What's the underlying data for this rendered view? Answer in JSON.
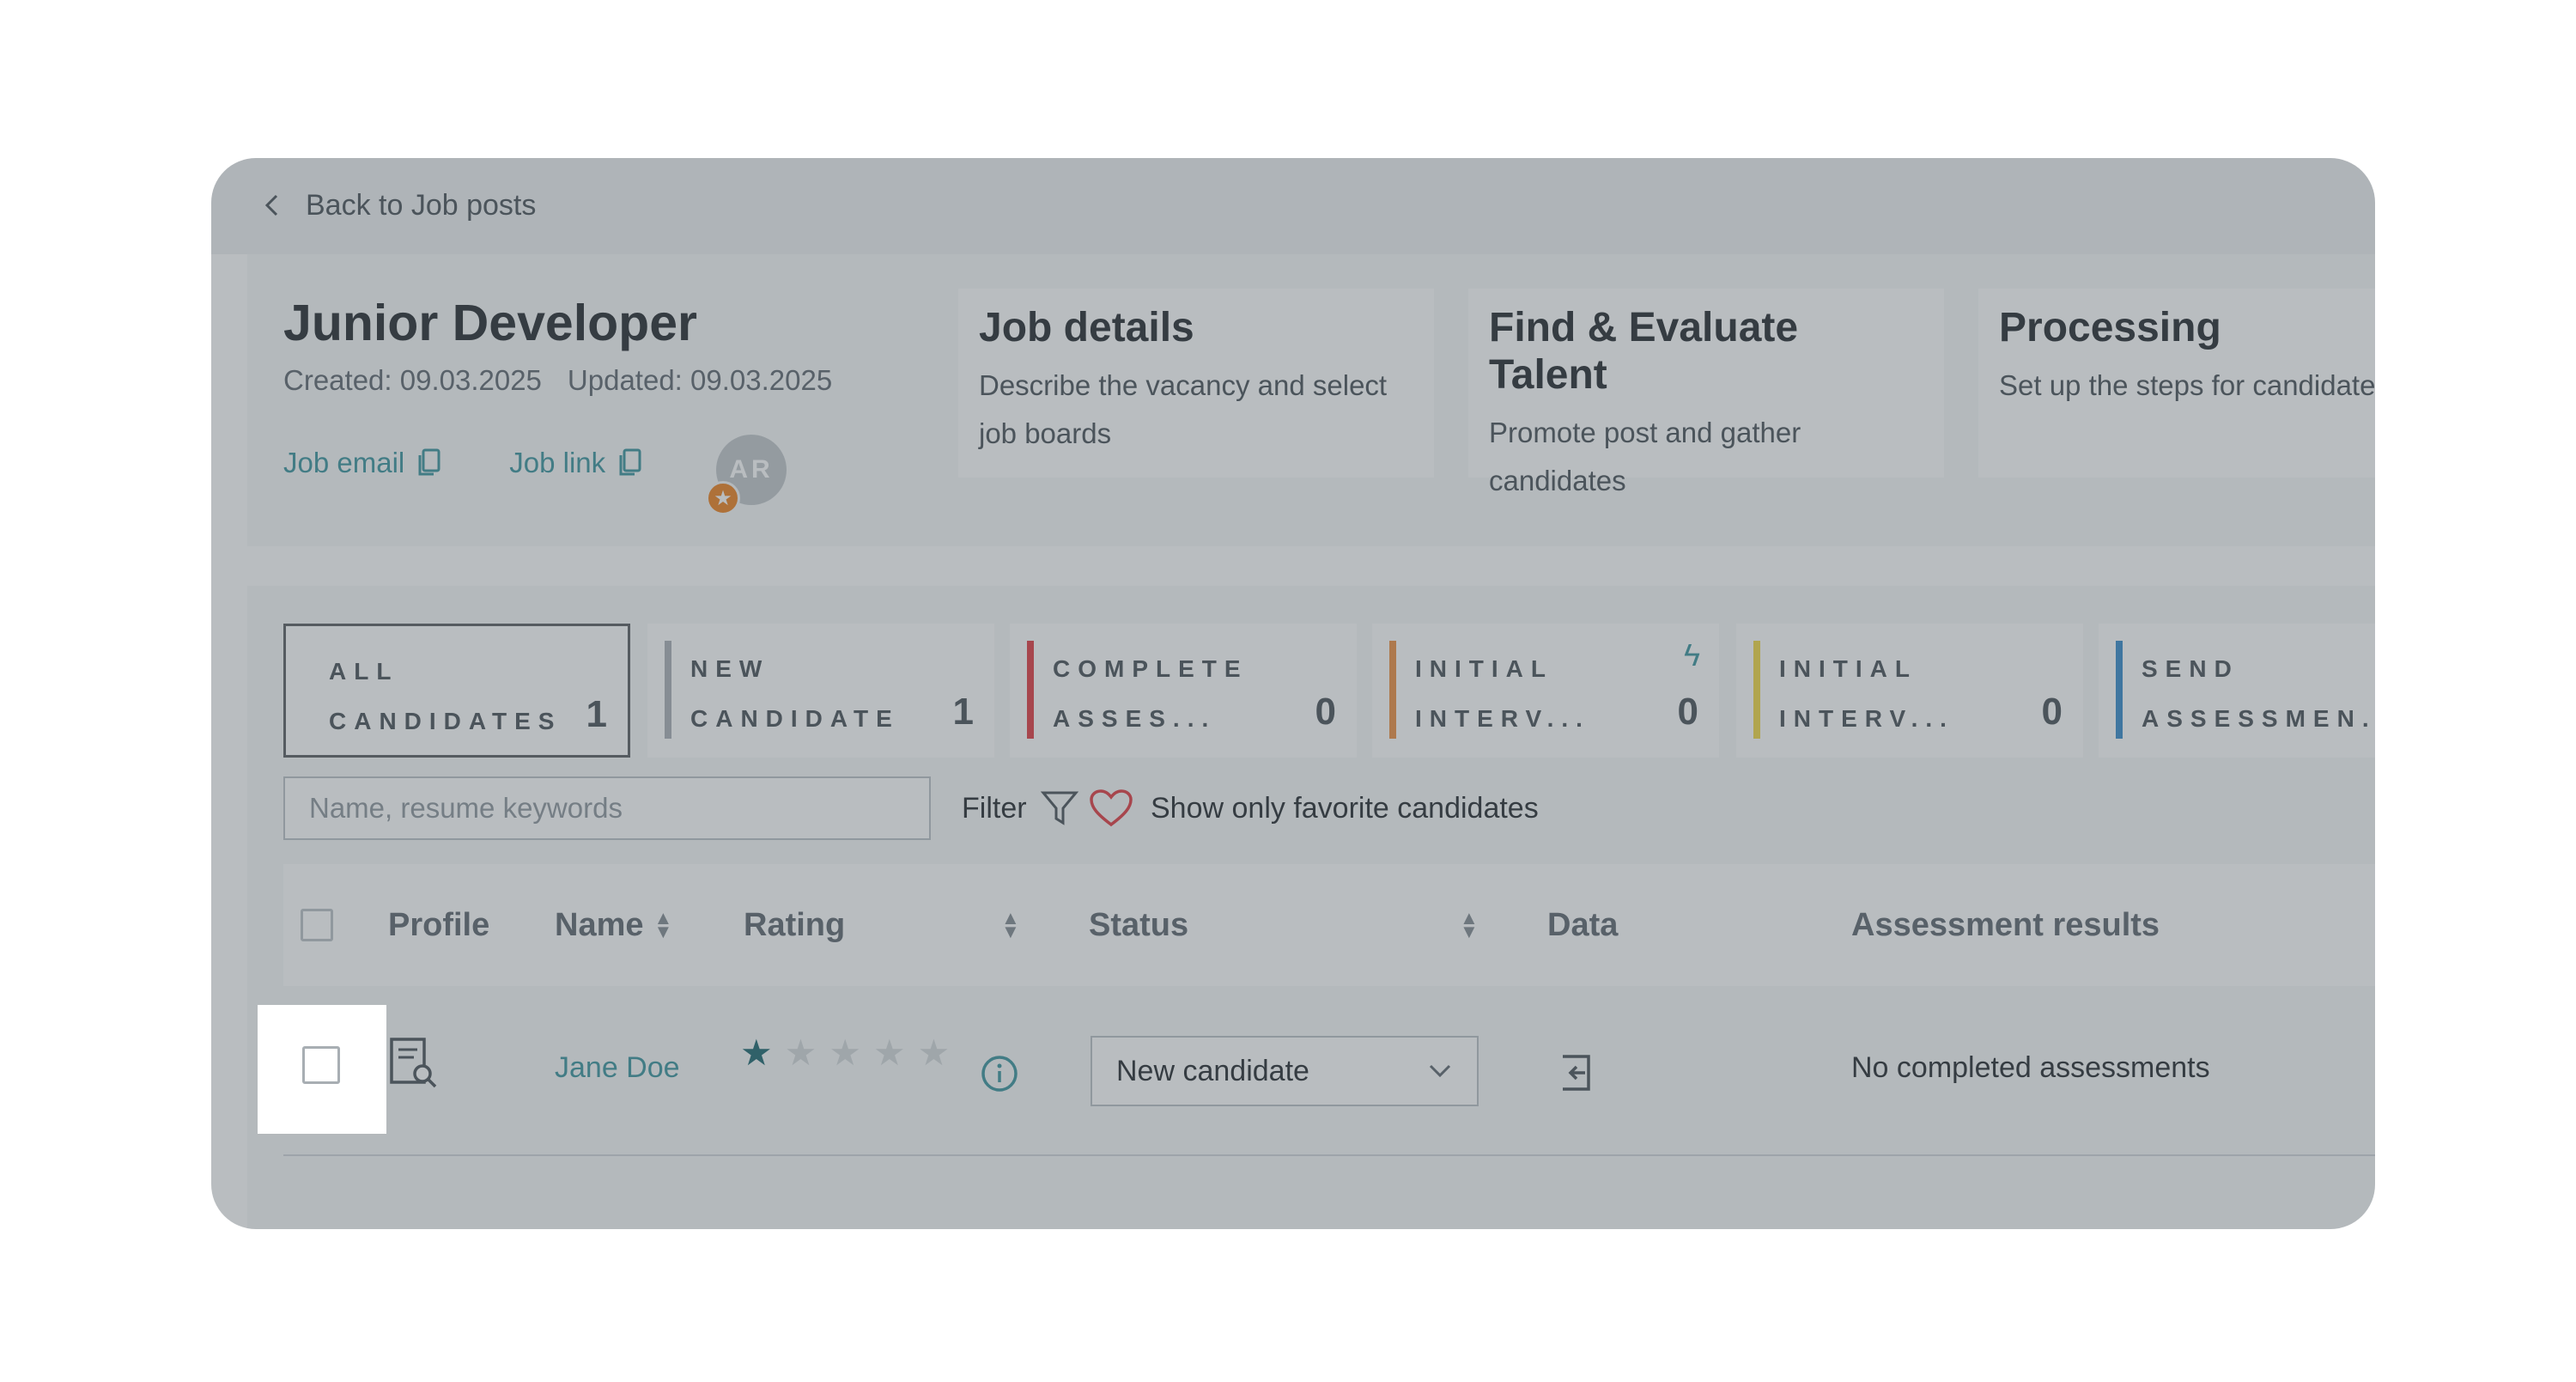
{
  "nav": {
    "back_label": "Back to Job posts"
  },
  "job": {
    "title": "Junior Developer",
    "created": "Created: 09.03.2025",
    "updated": "Updated: 09.03.2025",
    "job_email_label": "Job email",
    "job_link_label": "Job link",
    "avatar_initials": "AR"
  },
  "steps": [
    {
      "title": "Job details",
      "description": "Describe the vacancy and select job boards"
    },
    {
      "title": "Find & Evaluate Talent",
      "description": "Promote post and gather candidates"
    },
    {
      "title": "Processing",
      "description": "Set up the steps for candidates processing"
    }
  ],
  "pipeline_tabs": [
    {
      "label": "ALL CANDIDATES",
      "count": "1",
      "color": "#ffffff",
      "active": true
    },
    {
      "label": "NEW CANDIDATE",
      "count": "1",
      "color": "#a7adb3"
    },
    {
      "label": "COMPLETE ASSES...",
      "count": "0",
      "color": "#e0333a"
    },
    {
      "label": "INITIAL INTERV...",
      "count": "0",
      "color": "#ec8a3a",
      "icon": "lightning-icon"
    },
    {
      "label": "INITIAL INTERV...",
      "count": "0",
      "color": "#f2d63c"
    },
    {
      "label": "SEND ASSESSMEN...",
      "count": "",
      "color": "#2e86c8"
    }
  ],
  "toolbar": {
    "search_placeholder": "Name, resume keywords",
    "filter_label": "Filter",
    "favorites_label": "Show only favorite candidates"
  },
  "table": {
    "headers": {
      "profile": "Profile",
      "name": "Name",
      "rating": "Rating",
      "status": "Status",
      "data": "Data",
      "assessment": "Assessment results"
    },
    "rows": [
      {
        "name": "Jane Doe",
        "rating": 1,
        "rating_max": 5,
        "status": "New candidate",
        "assessment": "No completed assessments"
      }
    ]
  },
  "colors": {
    "accent": "#33909a",
    "overlay": "#586268"
  }
}
